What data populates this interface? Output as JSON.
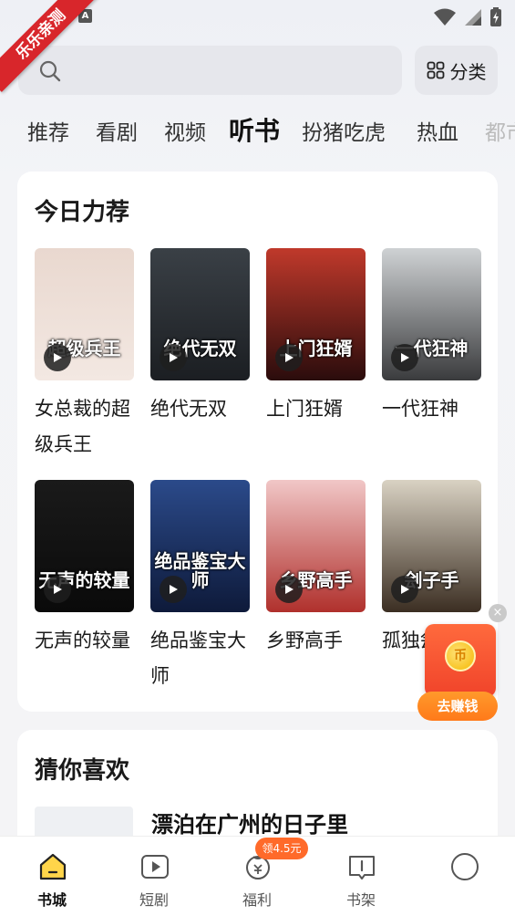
{
  "status": {
    "a_badge": "A"
  },
  "ribbon": "乐乐亲测",
  "search": {
    "placeholder": ""
  },
  "category_button": {
    "label": "分类"
  },
  "tabs": [
    "推荐",
    "看剧",
    "视频",
    "听书",
    "扮猪吃虎",
    "热血",
    "都市"
  ],
  "active_tab": "听书",
  "today": {
    "title": "今日力荐",
    "books": [
      {
        "title": "女总裁的超级兵王",
        "cover_text": "超级兵王",
        "cover_bg": "linear-gradient(180deg,#e9d8cf,#f3e8e2)"
      },
      {
        "title": "绝代无双",
        "cover_text": "绝代无双",
        "cover_bg": "linear-gradient(180deg,#3a4046,#1b1e22)"
      },
      {
        "title": "上门狂婿",
        "cover_text": "上门狂婿",
        "cover_bg": "linear-gradient(180deg,#c0392b,#2a0c0c)"
      },
      {
        "title": "一代狂神",
        "cover_text": "一代狂神",
        "cover_bg": "linear-gradient(180deg,#cfd2d4,#3a3b3d)"
      },
      {
        "title": "无声的较量",
        "cover_text": "无声的较量",
        "cover_bg": "linear-gradient(180deg,#1a1a1a,#0a0a0a)"
      },
      {
        "title": "绝品鉴宝大师",
        "cover_text": "绝品鉴宝大师",
        "cover_bg": "linear-gradient(180deg,#2b4a8a,#0e1a3a)"
      },
      {
        "title": "乡野高手",
        "cover_text": "乡野高手",
        "cover_bg": "linear-gradient(180deg,#f1c7c7,#b0302c)"
      },
      {
        "title": "孤独刽子手",
        "cover_text": "刽子手",
        "cover_bg": "linear-gradient(180deg,#d9d2c3,#3b2e22)"
      }
    ]
  },
  "guess": {
    "title": "猜你喜欢",
    "first_book_title": "漂泊在广州的日子里"
  },
  "float": {
    "close": "×",
    "coin": "币",
    "button": "去赚钱"
  },
  "bottom_nav": {
    "items": [
      {
        "label": "书城"
      },
      {
        "label": "短剧"
      },
      {
        "label": "福利"
      },
      {
        "label": "书架"
      },
      {
        "label": ""
      }
    ],
    "badge": "领4.5元"
  }
}
